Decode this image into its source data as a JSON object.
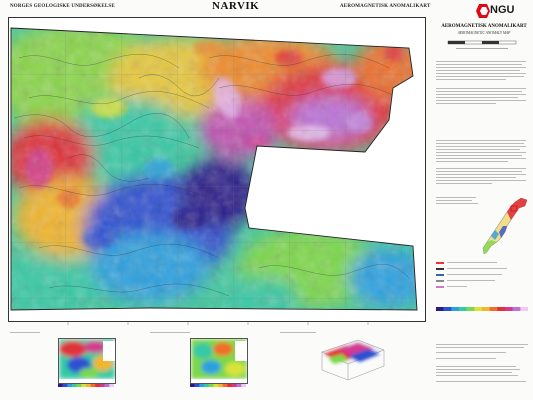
{
  "header": {
    "left": "NORGES GEOLOGISKE UNDERSØKELSE",
    "title": "NARVIK",
    "right": "AEROMAGNETISK ANOMALIKART"
  },
  "logo": {
    "text": "NGU"
  },
  "panel": {
    "title": "AEROMAGNETISK ANOMALIKART",
    "subtitle": "AEROMAGNETIC ANOMALY MAP"
  },
  "colors": {
    "ramp": [
      "#2b1a8a",
      "#2e4fd1",
      "#2aa0e0",
      "#36c9a4",
      "#7cd84a",
      "#d9e23a",
      "#f2b52b",
      "#ee6e2a",
      "#e0303a",
      "#d33a8f",
      "#b970d8",
      "#f0c9f5"
    ],
    "frame": "#333333",
    "inset_bg": "#ffffff"
  }
}
